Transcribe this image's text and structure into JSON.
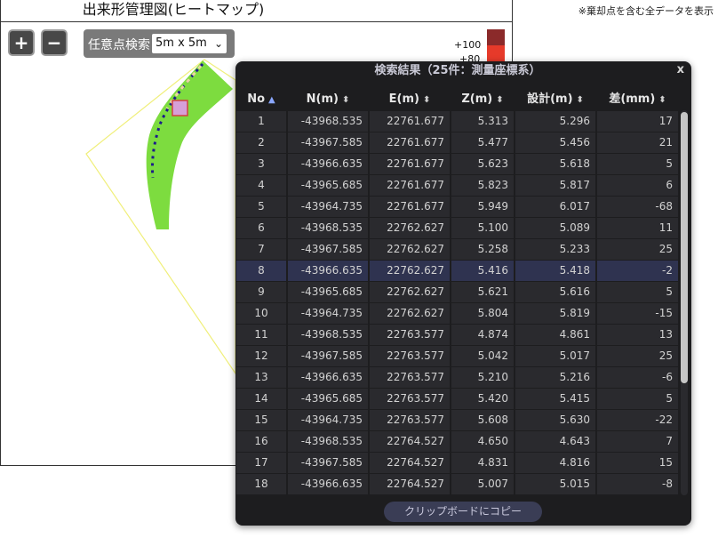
{
  "page": {
    "title": "出来形管理図(ヒートマップ)",
    "note": "※棄却点を含む全データを表示"
  },
  "toolbar": {
    "zoom_in_label": "+",
    "zoom_out_label": "−",
    "search_label": "任意点検索",
    "grid_size_value": "5m x 5m"
  },
  "legend": {
    "top_label": "+100",
    "second_label": "+80",
    "colors": [
      "#8b2a2a",
      "#e63a2a"
    ]
  },
  "map": {
    "outline_color": "#f0ef7a",
    "fill_color": "#7ddc3f",
    "marker_color": "#d6a0d8"
  },
  "dialog": {
    "title": "検索結果（25件：測量座標系）",
    "close_label": "x",
    "columns": [
      "No",
      "N(m)",
      "E(m)",
      "Z(m)",
      "設計(m)",
      "差(mm)"
    ],
    "rows": [
      [
        "1",
        "-43968.535",
        "22761.677",
        "5.313",
        "5.296",
        "17"
      ],
      [
        "2",
        "-43967.585",
        "22761.677",
        "5.477",
        "5.456",
        "21"
      ],
      [
        "3",
        "-43966.635",
        "22761.677",
        "5.623",
        "5.618",
        "5"
      ],
      [
        "4",
        "-43965.685",
        "22761.677",
        "5.823",
        "5.817",
        "6"
      ],
      [
        "5",
        "-43964.735",
        "22761.677",
        "5.949",
        "6.017",
        "-68"
      ],
      [
        "6",
        "-43968.535",
        "22762.627",
        "5.100",
        "5.089",
        "11"
      ],
      [
        "7",
        "-43967.585",
        "22762.627",
        "5.258",
        "5.233",
        "25"
      ],
      [
        "8",
        "-43966.635",
        "22762.627",
        "5.416",
        "5.418",
        "-2"
      ],
      [
        "9",
        "-43965.685",
        "22762.627",
        "5.621",
        "5.616",
        "5"
      ],
      [
        "10",
        "-43964.735",
        "22762.627",
        "5.804",
        "5.819",
        "-15"
      ],
      [
        "11",
        "-43968.535",
        "22763.577",
        "4.874",
        "4.861",
        "13"
      ],
      [
        "12",
        "-43967.585",
        "22763.577",
        "5.042",
        "5.017",
        "25"
      ],
      [
        "13",
        "-43966.635",
        "22763.577",
        "5.210",
        "5.216",
        "-6"
      ],
      [
        "14",
        "-43965.685",
        "22763.577",
        "5.420",
        "5.415",
        "5"
      ],
      [
        "15",
        "-43964.735",
        "22763.577",
        "5.608",
        "5.630",
        "-22"
      ],
      [
        "16",
        "-43968.535",
        "22764.527",
        "4.650",
        "4.643",
        "7"
      ],
      [
        "17",
        "-43967.585",
        "22764.527",
        "4.831",
        "4.816",
        "15"
      ],
      [
        "18",
        "-43966.635",
        "22764.527",
        "5.007",
        "5.015",
        "-8"
      ]
    ],
    "highlighted_row": 7,
    "copy_button_label": "クリップボードにコピー"
  }
}
